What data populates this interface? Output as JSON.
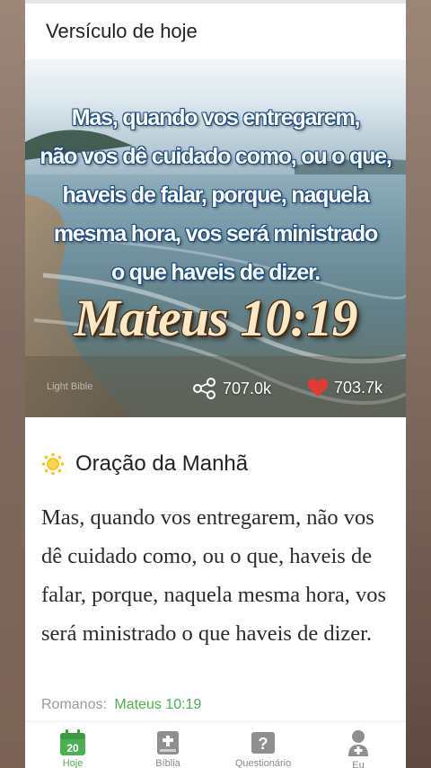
{
  "header": {
    "title": "Versículo de hoje"
  },
  "hero": {
    "verse_lines": [
      "Mas, quando vos entregarem,",
      "não vos dê cuidado como, ou o que,",
      "haveis de falar, porque, naquela",
      "mesma hora, vos será ministrado",
      "o que haveis de dizer."
    ],
    "reference": "Mateus 10:19",
    "watermark": "Light Bible",
    "shares": "707.0k",
    "likes": "703.7k"
  },
  "section": {
    "icon": "sun-icon",
    "title": "Oração da Manhã",
    "text": "Mas, quando vos entregarem, não vos dê cuidado como, ou o que, haveis de falar, porque, naquela mesma hora, vos será ministrado o que haveis de dizer.",
    "source_label": "Romanos:",
    "source_ref": "Mateus 10:19"
  },
  "tabs": [
    {
      "label": "Hoje",
      "icon": "calendar-icon",
      "badge": "20",
      "active": true
    },
    {
      "label": "Bíblia",
      "icon": "bible-icon",
      "active": false
    },
    {
      "label": "Questionário",
      "icon": "question-icon",
      "active": false
    },
    {
      "label": "Eu",
      "icon": "profile-icon",
      "active": false
    }
  ],
  "colors": {
    "accent": "#4caf50",
    "like": "#e53935",
    "sun": "#f6c324"
  }
}
